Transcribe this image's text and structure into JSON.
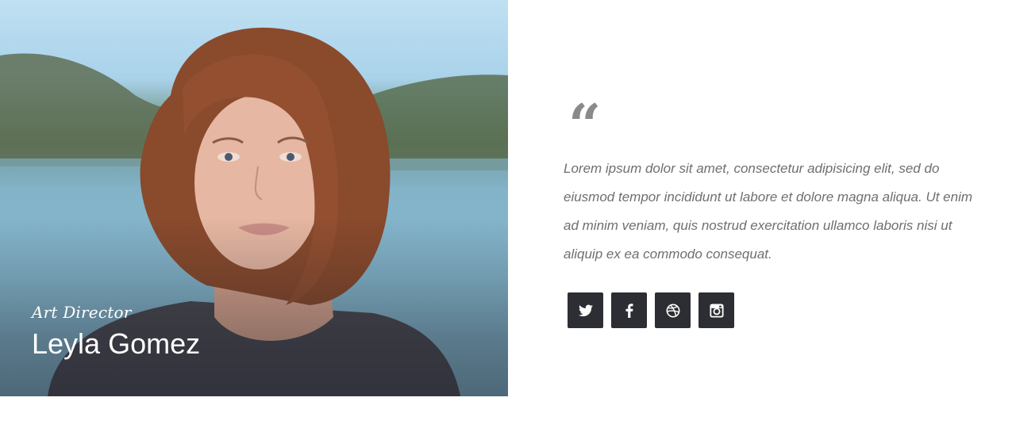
{
  "profile": {
    "role": "Art Director",
    "name": "Leyla Gomez"
  },
  "testimonial": {
    "quote_mark": "“",
    "text": "Lorem ipsum dolor sit amet, consectetur adipisicing elit, sed do eiusmod tempor incididunt ut labore et dolore magna aliqua. Ut enim ad minim veniam, quis nostrud exercitation ullamco laboris nisi ut aliquip ex ea commodo consequat."
  },
  "social": [
    {
      "icon": "twitter-icon"
    },
    {
      "icon": "facebook-icon"
    },
    {
      "icon": "dribbble-icon"
    },
    {
      "icon": "instagram-icon"
    }
  ],
  "colors": {
    "button_bg": "#2d2e33",
    "quote_text": "#6f6f6f",
    "quote_mark": "#8a8a8a"
  }
}
